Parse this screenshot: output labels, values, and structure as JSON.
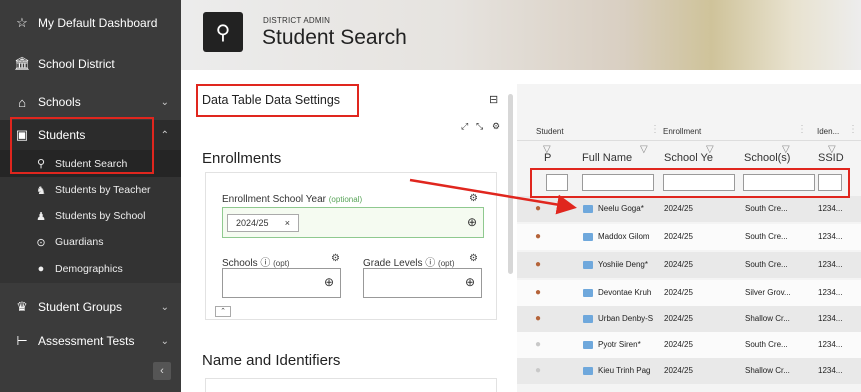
{
  "sidebar": {
    "items": [
      {
        "label": "My Default Dashboard",
        "icon": "star-icon"
      },
      {
        "label": "School District",
        "icon": "district-icon"
      },
      {
        "label": "Schools",
        "icon": "school-icon"
      },
      {
        "label": "Students",
        "icon": "student-file-icon"
      }
    ],
    "student_subitems": [
      {
        "label": "Student Search",
        "icon": "search-icon"
      },
      {
        "label": "Students by Teacher",
        "icon": "teacher-icon"
      },
      {
        "label": "Students by School",
        "icon": "school-student-icon"
      },
      {
        "label": "Guardians",
        "icon": "guardian-icon"
      },
      {
        "label": "Demographics",
        "icon": "person-icon"
      }
    ],
    "lower_items": [
      {
        "label": "Student Groups",
        "icon": "group-icon"
      },
      {
        "label": "Assessment Tests",
        "icon": "test-icon"
      }
    ]
  },
  "header": {
    "role": "DISTRICT ADMIN",
    "title": "Student Search"
  },
  "settings": {
    "title": "Data Table Data Settings",
    "enrollments_heading": "Enrollments",
    "enrollment_year_label": "Enrollment School Year",
    "enrollment_year_optional": "(optional)",
    "enrollment_year_value": "2024/25",
    "chip_remove": "×",
    "schools_label": "Schools",
    "schools_opt": "(opt)",
    "grade_levels_label": "Grade Levels",
    "grade_levels_opt": "(opt)",
    "name_heading": "Name and Identifiers"
  },
  "table": {
    "group_headers": [
      "Student",
      "Enrollment",
      "Iden..."
    ],
    "column_headers": [
      "P",
      "Full Name",
      "School Ye",
      "School(s)",
      "SSID"
    ],
    "rows": [
      {
        "name": "Neelu Goga*",
        "year": "2024/25",
        "school": "South Cre...",
        "ssid": "1234...",
        "photo": "photo"
      },
      {
        "name": "Maddox Gilom",
        "year": "2024/25",
        "school": "South Cre...",
        "ssid": "1234...",
        "photo": "photo"
      },
      {
        "name": "Yoshiie Deng*",
        "year": "2024/25",
        "school": "South Cre...",
        "ssid": "1234...",
        "photo": "photo"
      },
      {
        "name": "Devontae Kruh",
        "year": "2024/25",
        "school": "Silver Grov...",
        "ssid": "1234...",
        "photo": "photo"
      },
      {
        "name": "Urban Denby-S",
        "year": "2024/25",
        "school": "Shallow Cr...",
        "ssid": "1234...",
        "photo": "photo"
      },
      {
        "name": "Pyotr Siren*",
        "year": "2024/25",
        "school": "South Cre...",
        "ssid": "1234...",
        "photo": "placeholder"
      },
      {
        "name": "Kieu Trinh Pag",
        "year": "2024/25",
        "school": "Shallow Cr...",
        "ssid": "1234...",
        "photo": "placeholder"
      }
    ]
  },
  "colors": {
    "annotation_red": "#e0261e",
    "sidebar_bg": "#3b3b3b",
    "optional_green": "#58a458"
  }
}
